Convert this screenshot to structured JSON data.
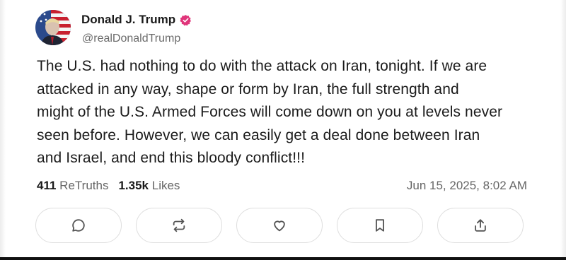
{
  "author": {
    "display_name": "Donald J. Trump",
    "handle": "@realDonaldTrump",
    "avatar_icon": "avatar-portrait-flag",
    "verified_icon": "verified-badge-icon",
    "verified_color": "#e0357a"
  },
  "post": {
    "lines": [
      "The U.S. had nothing to do with the attack on Iran, tonight. If we are",
      "attacked in any way, shape or form by Iran, the full strength and",
      "might of the U.S. Armed Forces will come down on you at levels never",
      "seen before. However, we can easily get a deal done between Iran",
      "and Israel, and end this bloody conflict!!!"
    ]
  },
  "stats": {
    "retruths_count": "411",
    "retruths_label": "ReTruths",
    "likes_count": "1.35k",
    "likes_label": "Likes",
    "timestamp": "Jun 15, 2025, 8:02 AM"
  },
  "actions": [
    {
      "name": "reply",
      "icon": "comment-icon"
    },
    {
      "name": "retruth",
      "icon": "repost-icon"
    },
    {
      "name": "like",
      "icon": "heart-icon"
    },
    {
      "name": "bookmark",
      "icon": "bookmark-icon"
    },
    {
      "name": "share",
      "icon": "share-icon"
    }
  ]
}
